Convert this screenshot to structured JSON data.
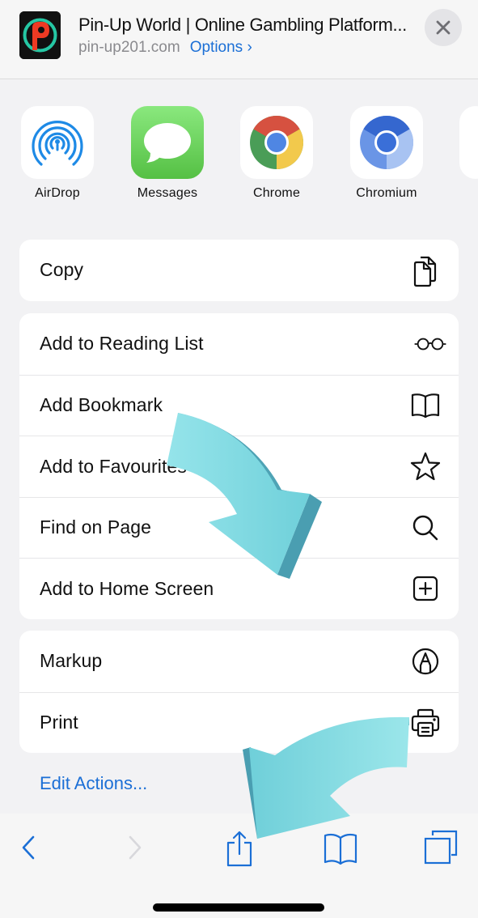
{
  "header": {
    "site_icon": "pin-up-logo",
    "title": "Pin-Up World | Online Gambling Platform...",
    "domain": "pin-up201.com",
    "options_label": "Options",
    "options_icon": "chevron-right-icon",
    "close_icon": "close-icon"
  },
  "apps": [
    {
      "label": "AirDrop",
      "icon": "airdrop-icon"
    },
    {
      "label": "Messages",
      "icon": "messages-icon"
    },
    {
      "label": "Chrome",
      "icon": "chrome-icon"
    },
    {
      "label": "Chromium",
      "icon": "chromium-icon"
    }
  ],
  "groups": [
    {
      "items": [
        {
          "label": "Copy",
          "icon": "copy-icon"
        }
      ]
    },
    {
      "items": [
        {
          "label": "Add to Reading List",
          "icon": "glasses-icon"
        },
        {
          "label": "Add Bookmark",
          "icon": "book-icon"
        },
        {
          "label": "Add to Favourites",
          "icon": "star-icon"
        },
        {
          "label": "Find on Page",
          "icon": "search-icon"
        },
        {
          "label": "Add to Home Screen",
          "icon": "plus-square-icon"
        }
      ]
    },
    {
      "items": [
        {
          "label": "Markup",
          "icon": "markup-icon"
        },
        {
          "label": "Print",
          "icon": "printer-icon"
        }
      ]
    }
  ],
  "edit_actions_label": "Edit Actions...",
  "toolbar": {
    "items": [
      {
        "name": "back",
        "icon": "chevron-left-icon"
      },
      {
        "name": "forward",
        "icon": "chevron-right-icon",
        "disabled": true
      },
      {
        "name": "share",
        "icon": "share-icon"
      },
      {
        "name": "bookmarks",
        "icon": "book-icon"
      },
      {
        "name": "tabs",
        "icon": "tabs-icon"
      }
    ]
  },
  "colors": {
    "accent": "#1b6fd6",
    "arrow": "#7fd8df",
    "arrow_shade": "#4ea3b5",
    "background": "#f2f2f4"
  }
}
